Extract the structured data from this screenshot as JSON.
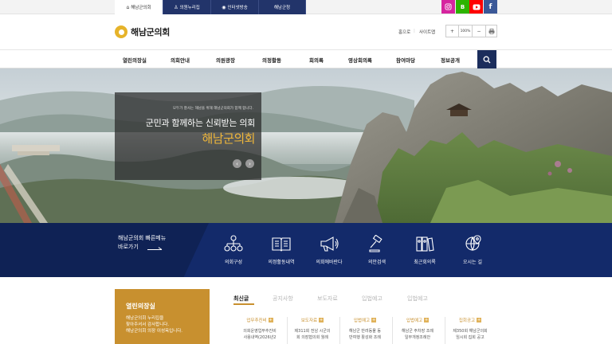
{
  "top_tabs": [
    {
      "label": "해남군의회",
      "icon": "home-icon"
    },
    {
      "label": "의원누리집",
      "icon": "person-icon"
    },
    {
      "label": "인터넷방송",
      "icon": "broadcast-icon"
    },
    {
      "label": "해남군청",
      "icon": ""
    }
  ],
  "social": [
    {
      "name": "instagram-icon",
      "glyph": "◎",
      "color": "#d6249f"
    },
    {
      "name": "blog-icon",
      "glyph": "B",
      "color": "#2db400"
    },
    {
      "name": "youtube-icon",
      "glyph": "▶",
      "color": "#ff0000"
    },
    {
      "name": "facebook-icon",
      "glyph": "f",
      "color": "#3b5998"
    }
  ],
  "header": {
    "logo_text": "해남군의회",
    "home_label": "홈으로",
    "sitemap_label": "사이트맵",
    "zoom_in": "+",
    "zoom_value": "100%",
    "zoom_out": "−",
    "print_icon": "print-icon"
  },
  "nav": {
    "items": [
      "열린의장실",
      "의회안내",
      "의원광장",
      "의정활동",
      "회의록",
      "영상회의록",
      "참여마당",
      "정보공개"
    ],
    "search_icon": "search-icon"
  },
  "hero": {
    "small_text": "모두가 잘사는 해남을 위해 해남군의회가 함께 합니다.",
    "main_text": "군민과 함께하는 신뢰받는 의회",
    "name_text": "해남군의회",
    "prev_label": "‹",
    "next_label": "›"
  },
  "quick_menu": {
    "title_line1": "해남군의회 빠른메뉴",
    "title_line2": "바로가기",
    "items": [
      {
        "label": "의회구성",
        "icon": "organization-icon"
      },
      {
        "label": "의정활동내역",
        "icon": "book-icon"
      },
      {
        "label": "의회에바란다",
        "icon": "megaphone-icon"
      },
      {
        "label": "의안검색",
        "icon": "gavel-icon"
      },
      {
        "label": "최근회의록",
        "icon": "binders-icon"
      },
      {
        "label": "오시는 길",
        "icon": "map-pin-icon"
      }
    ]
  },
  "open_office": {
    "title": "열린의장실",
    "lines": [
      "해남군의회 누리집을",
      "찾아주셔서 감사합니다.",
      "해남군의회 의장 이성옥입니다."
    ]
  },
  "news_tabs": [
    "최신글",
    "공지사항",
    "보도자료",
    "입법예고",
    "입법예고"
  ],
  "news_tabs_active": 0,
  "news_cards": [
    {
      "category": "업무추진비",
      "lines": [
        "의회운영업무추진비",
        "사용내역(2026년2"
      ]
    },
    {
      "category": "보도자료",
      "lines": [
        "제311회 전남 시군의",
        "회 의장협의회 월례"
      ]
    },
    {
      "category": "입법예고",
      "lines": [
        "해남군 반려동물 동",
        "반여행 활성화 조례"
      ]
    },
    {
      "category": "입법예고",
      "lines": [
        "해남군 주차장 조례",
        "일부개정조례안"
      ]
    },
    {
      "category": "집회공고",
      "lines": [
        "제350회 해남군의회",
        "임시회 집회 공고"
      ]
    }
  ],
  "colors": {
    "navy": "#132a6a",
    "gold": "#c8902f",
    "hero_accent": "#f0b73a"
  }
}
